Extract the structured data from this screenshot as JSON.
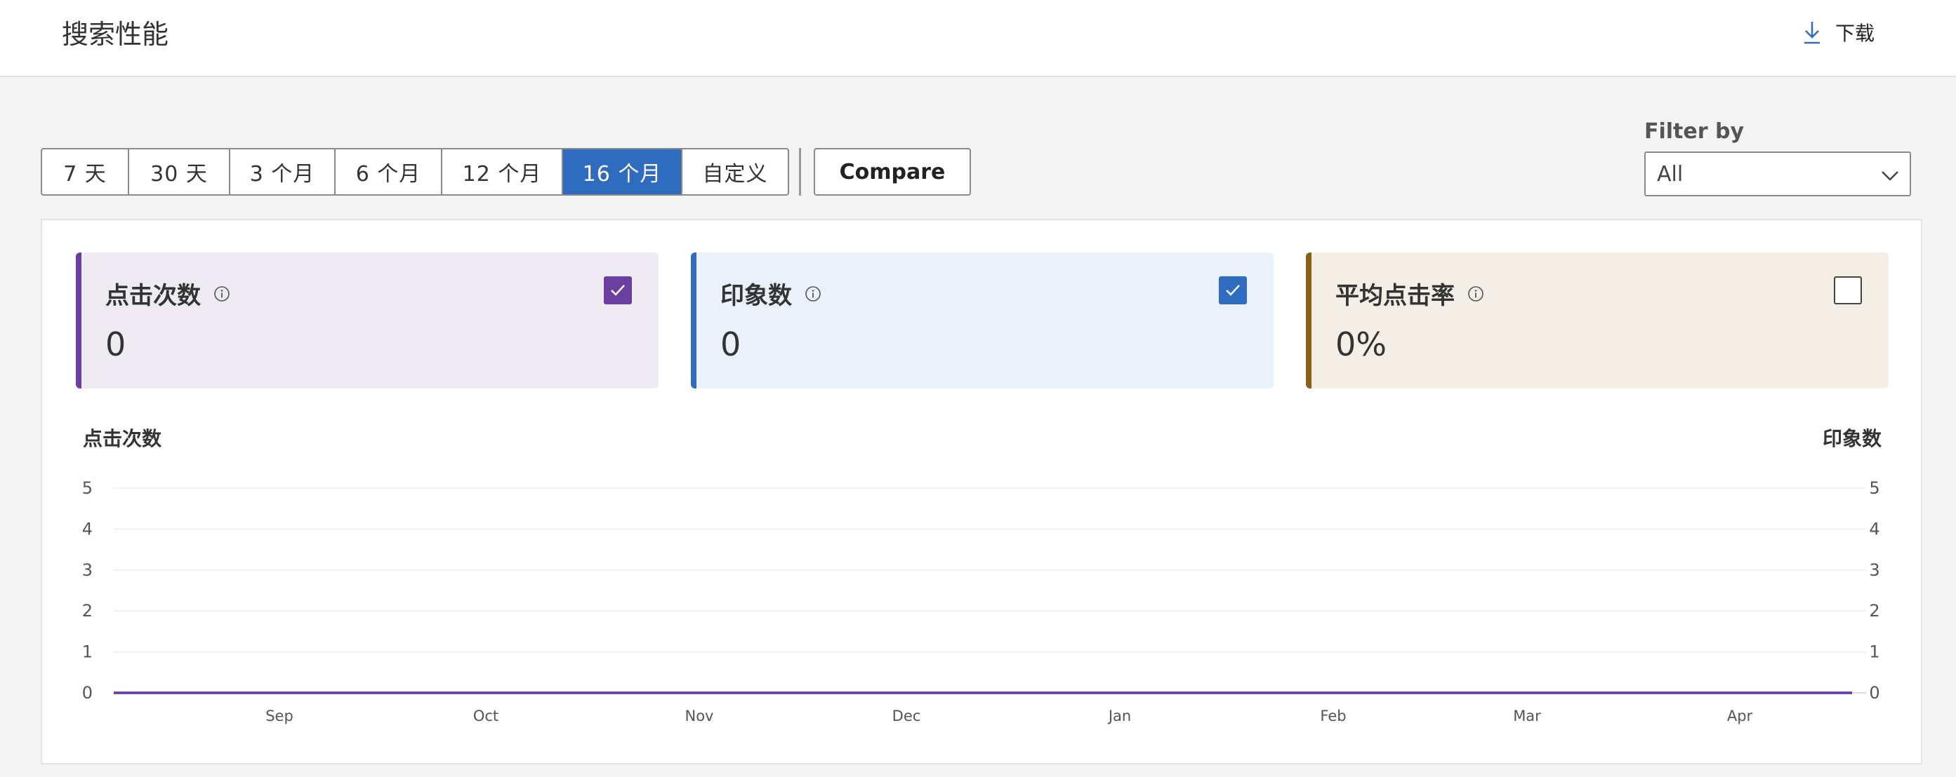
{
  "header": {
    "title": "搜索性能",
    "download_label": "下载",
    "download_icon": "download-icon"
  },
  "toolbar": {
    "ranges": [
      "7 天",
      "30 天",
      "3 个月",
      "6 个月",
      "12 个月",
      "16 个月",
      "自定义"
    ],
    "active_range": "16 个月",
    "compare_label": "Compare"
  },
  "filter": {
    "label": "Filter by",
    "value": "All"
  },
  "metrics": [
    {
      "title": "点击次数",
      "value": "0",
      "checked": true,
      "color": "#6a3fa0",
      "bg": "#efebf3"
    },
    {
      "title": "印象数",
      "value": "0",
      "checked": true,
      "color": "#2f6cc0",
      "bg": "#eaf1fb"
    },
    {
      "title": "平均点击率",
      "value": "0%",
      "checked": false,
      "color": "#8a6215",
      "bg": "#f3efe7"
    }
  ],
  "chart_data": {
    "type": "line",
    "left_axis_label": "点击次数",
    "right_axis_label": "印象数",
    "y_ticks": [
      0,
      1,
      2,
      3,
      4,
      5
    ],
    "ylim": [
      0,
      5
    ],
    "x_ticks": [
      "Sep",
      "Oct",
      "Nov",
      "Dec",
      "Jan",
      "Feb",
      "Mar",
      "Apr"
    ],
    "grid": true,
    "series": [
      {
        "name": "点击次数",
        "color": "#6a3fa0",
        "values": [
          0,
          0,
          0,
          0,
          0,
          0,
          0,
          0
        ]
      },
      {
        "name": "印象数",
        "color": "#2f6cc0",
        "values": [
          0,
          0,
          0,
          0,
          0,
          0,
          0,
          0
        ]
      }
    ]
  }
}
